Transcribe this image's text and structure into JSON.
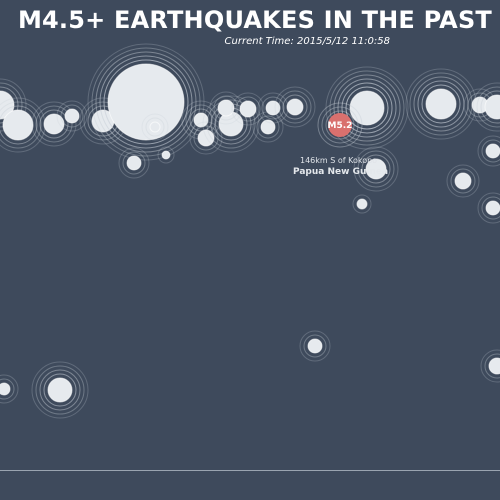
{
  "header": {
    "title": "M4.5+ EARTHQUAKES IN THE PAST",
    "current_time": "Current Time: 2015/5/12 11:0:58"
  },
  "highlight": {
    "magnitude_label": "M5.2",
    "distance_label": "146km S of Kokopo",
    "region_label": "Papua New Guinea",
    "color": "#d9706e"
  },
  "colors": {
    "background": "#3e4a5c",
    "quake_fill": "#e6eaee",
    "ring": "#c9d0d8",
    "baseline": "#9aa4b0"
  }
}
